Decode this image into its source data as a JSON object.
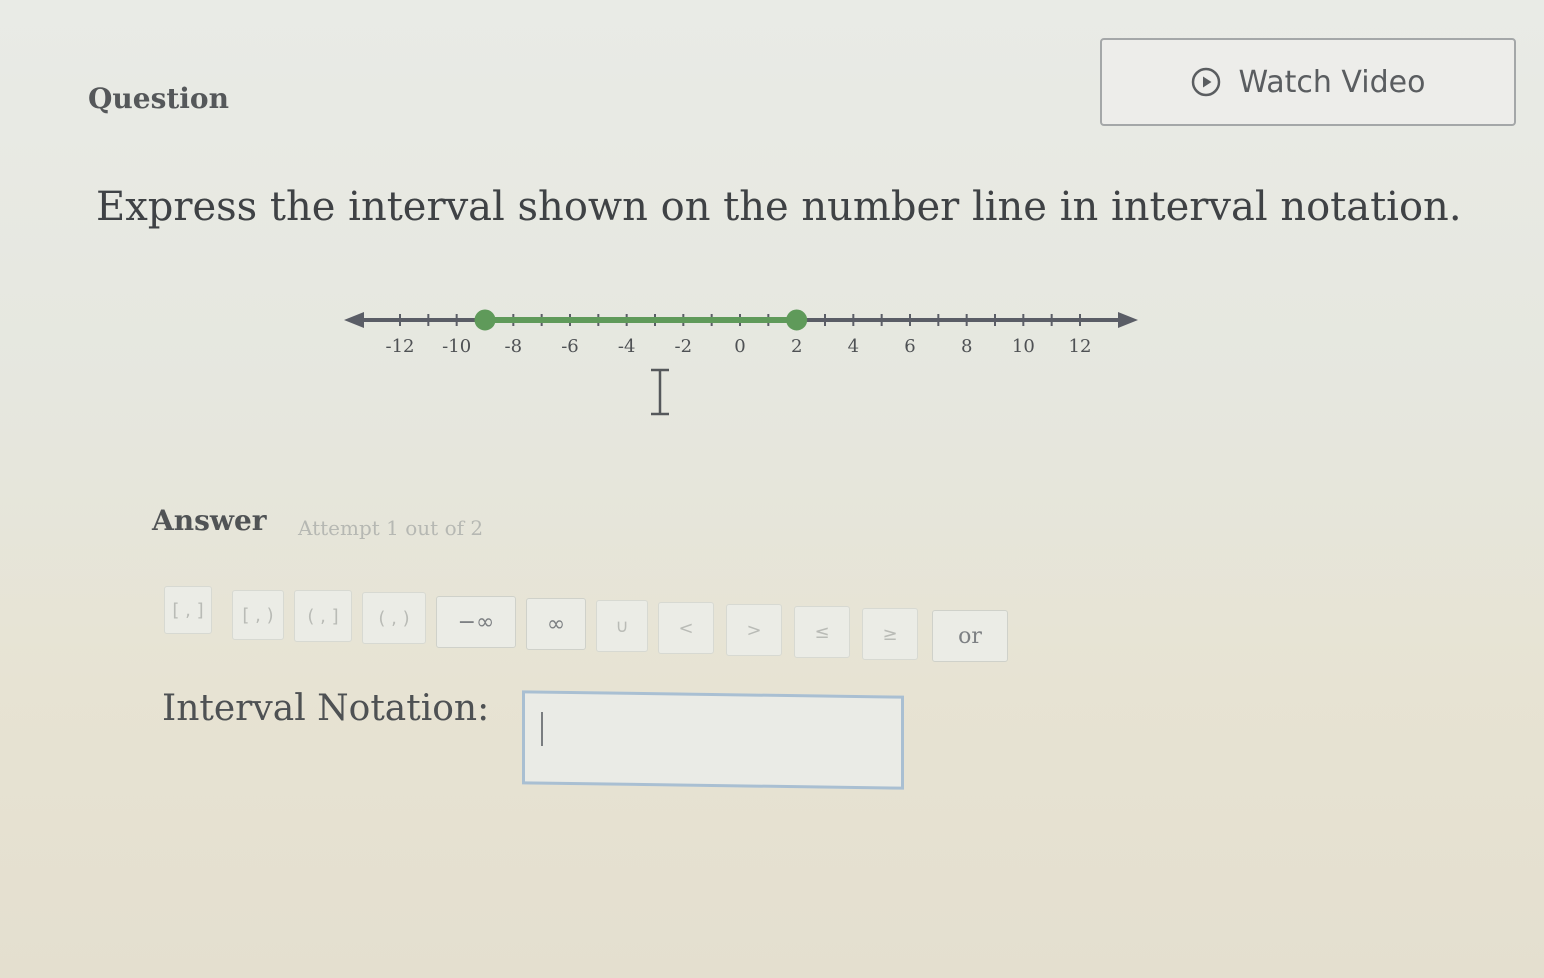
{
  "question": {
    "label": "Question",
    "watch_video_label": "Watch Video",
    "prompt": "Express the interval shown on the number line in interval notation."
  },
  "number_line": {
    "min": -12,
    "max": 12,
    "tick_step": 1,
    "label_values": [
      -12,
      -10,
      -8,
      -6,
      -4,
      -2,
      0,
      2,
      4,
      6,
      8,
      10,
      12
    ],
    "labels": [
      "-12",
      "-10",
      "-8",
      "-6",
      "-4",
      "-2",
      "0",
      "2",
      "4",
      "6",
      "8",
      "10",
      "12"
    ],
    "endpoints": [
      {
        "value": -9,
        "closed": true
      },
      {
        "value": 2,
        "closed": true
      }
    ],
    "highlight_color": "#5f9a5a",
    "line_color": "#5a5d66"
  },
  "answer": {
    "label": "Answer",
    "attempt": "Attempt 1 out of 2",
    "toolbar": [
      {
        "symbol": "[ , ]"
      },
      {
        "symbol": "[ , )"
      },
      {
        "symbol": "( , ]"
      },
      {
        "symbol": "( , )"
      },
      {
        "symbol": "−∞"
      },
      {
        "symbol": "∞"
      },
      {
        "symbol": "∪"
      },
      {
        "symbol": "<"
      },
      {
        "symbol": ">"
      },
      {
        "symbol": "≤"
      },
      {
        "symbol": "≥"
      },
      {
        "symbol": "or"
      }
    ],
    "notation_label": "Interval Notation:",
    "notation_value": ""
  }
}
